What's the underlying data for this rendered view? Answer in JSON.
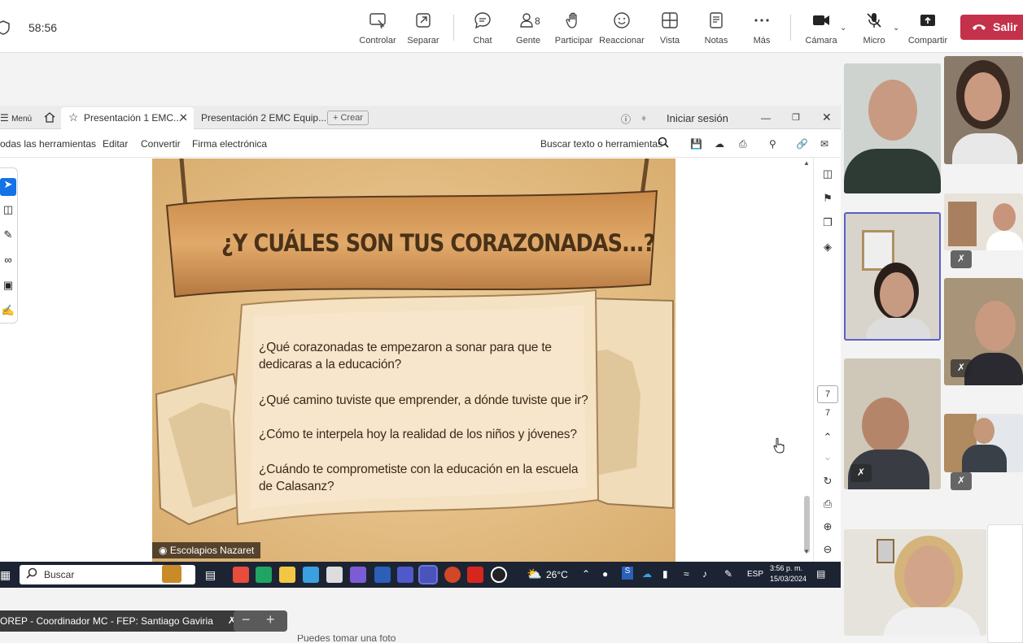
{
  "meeting": {
    "timer": "58:56",
    "toolbar": [
      {
        "label": "Controlar",
        "icon": "control-icon"
      },
      {
        "label": "Separar",
        "icon": "popout-icon"
      },
      {
        "label": "Chat",
        "icon": "chat-icon"
      },
      {
        "label": "Gente",
        "icon": "people-icon",
        "count": "8"
      },
      {
        "label": "Participar",
        "icon": "raise-hand-icon"
      },
      {
        "label": "Reaccionar",
        "icon": "react-icon"
      },
      {
        "label": "Vista",
        "icon": "view-icon"
      },
      {
        "label": "Notas",
        "icon": "notes-icon"
      },
      {
        "label": "Más",
        "icon": "more-icon"
      },
      {
        "label": "Cámara",
        "icon": "camera-icon"
      },
      {
        "label": "Micro",
        "icon": "mic-off-icon"
      },
      {
        "label": "Compartir",
        "icon": "share-icon"
      }
    ],
    "leave_label": "Salir",
    "leave_color": "#c4314b"
  },
  "acrobat": {
    "menu_label": "Menú",
    "tabs": [
      "Presentación 1 EMC...",
      "Presentación 2 EMC Equip..."
    ],
    "create_label": "Crear",
    "signin_label": "Iniciar sesión",
    "menu_items": [
      "odas las herramientas",
      "Editar",
      "Convertir",
      "Firma electrónica"
    ],
    "search_label": "Buscar texto o herramientas",
    "page_current": "7",
    "page_total": "7"
  },
  "slide": {
    "title": "¿Y CUÁLES SON TUS CORAZONADAS...?",
    "questions": [
      "¿Qué corazonadas te empezaron a sonar para que te dedicaras a la educación?",
      "¿Qué camino tuviste que emprender,  a dónde tuviste que ir?",
      "¿Cómo te interpela hoy la realidad de los niños y jóvenes?",
      "¿Cuándo te comprometiste con la educación en la escuela de Calasanz?"
    ],
    "watermark": "Escolapios Nazaret"
  },
  "taskbar": {
    "search_label": "Buscar",
    "weather": "26°C",
    "lang": "ESP",
    "time": "3:56 p. m.",
    "date": "15/03/2024"
  },
  "presenter": {
    "name": "OREP - Coordinador MC - FEP: Santiago Gaviria"
  },
  "bottom_text": "Puedes tomar una foto"
}
